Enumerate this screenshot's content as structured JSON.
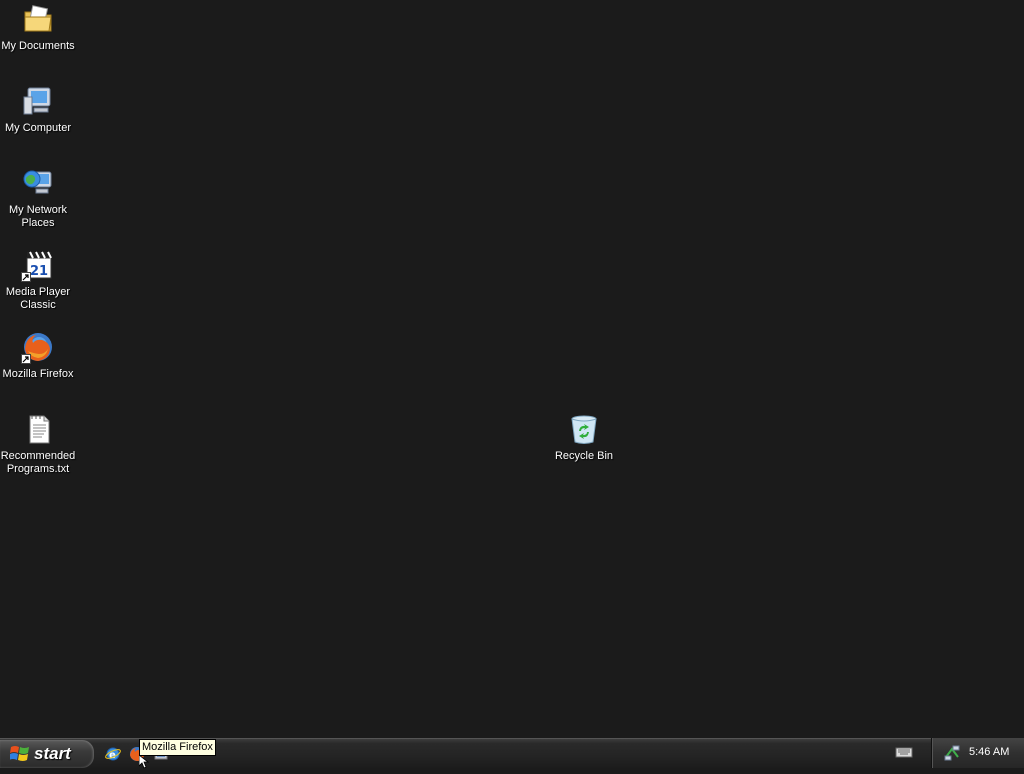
{
  "desktop": {
    "icons": [
      {
        "label": "My Documents",
        "icon": "my-documents-icon"
      },
      {
        "label": "My Computer",
        "icon": "my-computer-icon"
      },
      {
        "label": "My Network Places",
        "icon": "network-places-icon"
      },
      {
        "label": "Media Player Classic",
        "icon": "media-player-classic-icon"
      },
      {
        "label": "Mozilla Firefox",
        "icon": "firefox-icon"
      },
      {
        "label": "Recommended Programs.txt",
        "icon": "text-file-icon"
      },
      {
        "label": "Recycle Bin",
        "icon": "recycle-bin-icon"
      }
    ]
  },
  "taskbar": {
    "start_label": "start",
    "quick_launch": [
      {
        "name": "internet-explorer-icon"
      },
      {
        "name": "firefox-icon"
      },
      {
        "name": "show-desktop-icon"
      }
    ],
    "tooltip": "Mozilla Firefox",
    "tray": {
      "clock": "5:46 AM",
      "icons": [
        "keyboard-icon",
        "network-icon"
      ]
    }
  },
  "colors": {
    "desktop_bg": "#1b1b1b",
    "taskbar_bg": "#242424",
    "tooltip_bg": "#ffffe1"
  }
}
